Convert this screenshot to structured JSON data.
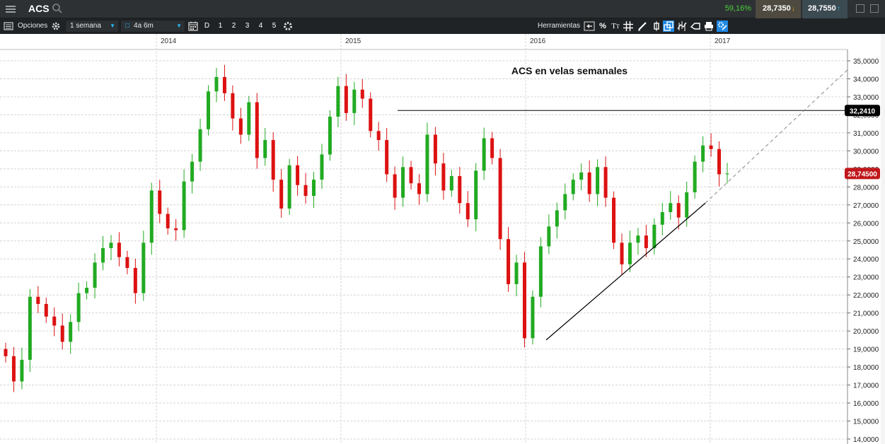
{
  "header": {
    "ticker": "ACS",
    "pct_change": "59,16%",
    "sell_price": "28,7350",
    "buy_price": "28,7550",
    "colors": {
      "up": "#4ccf3a",
      "sell_bg": "#4e4a40",
      "buy_bg": "#3c4a52"
    }
  },
  "toolbar": {
    "options_label": "Opciones",
    "interval_value": "1 semana",
    "range_value": "4a 6m",
    "periods": [
      "D",
      "1",
      "2",
      "3",
      "4",
      "5"
    ],
    "tools_label": "Herramientas",
    "tool_icons": [
      "zoom-fit-icon",
      "percent-icon",
      "text-tool-icon",
      "grid-icon",
      "draw-pencil-icon",
      "candle-type-icon",
      "compare-icon",
      "indicator-icon",
      "eraser-icon",
      "print-icon",
      "settings-tools-icon"
    ]
  },
  "chart_data": {
    "type": "candlestick",
    "title": "ACS en velas semanales",
    "x_labels": [
      "2014",
      "2015",
      "2016",
      "2017"
    ],
    "y_ticks": [
      "14,0000",
      "15,0000",
      "16,0000",
      "17,0000",
      "18,0000",
      "19,0000",
      "20,0000",
      "21,0000",
      "22,0000",
      "23,0000",
      "24,0000",
      "25,0000",
      "26,0000",
      "27,0000",
      "28,0000",
      "29,0000",
      "30,0000",
      "31,0000",
      "32,0000",
      "33,0000",
      "34,0000",
      "35,0000"
    ],
    "ylim": [
      14,
      35.6
    ],
    "grid": true,
    "colors": {
      "up": "#22aa22",
      "down": "#dd1111"
    },
    "candle_closes": [
      18.6,
      17.2,
      18.4,
      21.9,
      21.5,
      20.8,
      20.3,
      19.4,
      20.5,
      22.1,
      22.4,
      23.8,
      24.6,
      24.9,
      24.1,
      23.5,
      22.1,
      24.9,
      27.8,
      26.5,
      25.7,
      25.6,
      28.3,
      29.4,
      31.2,
      33.3,
      34.1,
      33.2,
      31.8,
      30.9,
      32.7,
      29.6,
      30.6,
      28.4,
      26.8,
      29.2,
      28.1,
      27.5,
      28.4,
      29.8,
      31.9,
      33.6,
      32.1,
      33.4,
      32.9,
      31.1,
      30.6,
      28.7,
      27.4,
      29.1,
      28.2,
      27.6,
      30.9,
      29.3,
      27.8,
      28.6,
      27.1,
      26.2,
      28.9,
      30.7,
      29.6,
      25.1,
      22.6,
      23.8,
      19.6,
      21.9,
      24.7,
      25.8,
      26.7,
      27.6,
      28.4,
      28.8,
      27.6,
      29.1,
      27.4,
      24.9,
      23.7,
      24.9,
      25.3,
      24.6,
      25.9,
      26.6,
      27.1,
      26.3,
      27.7,
      29.4,
      30.3,
      30.1,
      28.7,
      28.745
    ],
    "trendline_support": {
      "from": [
        "2016",
        19.5
      ],
      "to": [
        "2017",
        27.1
      ],
      "projected_to": 34.5
    },
    "horizontal_resistance": {
      "value": 32.241,
      "label": "32,2410"
    },
    "last_price": {
      "value": 28.745,
      "label": "28,74500"
    }
  }
}
